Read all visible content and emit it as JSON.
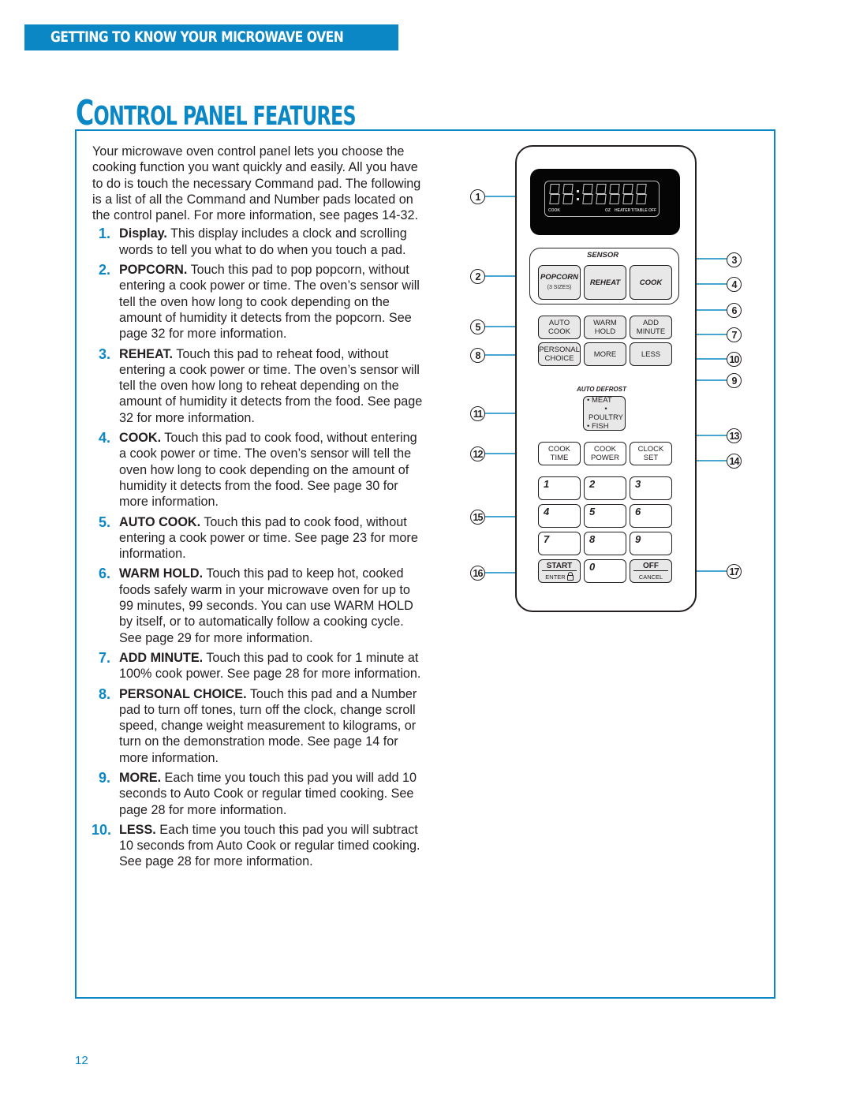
{
  "header": {
    "section_title": "GETTING TO KNOW YOUR MICROWAVE OVEN",
    "page_title_cap": "C",
    "page_title_rest": "ONTROL PANEL FEATURES"
  },
  "intro": "Your microwave oven control panel lets you choose the cooking function you want quickly and easily. All you have to do is touch the necessary Command pad. The following is a list of all the Command and Number pads located on the control panel. For more information, see pages 14-32.",
  "items": [
    {
      "num": "1.",
      "term": "Display.",
      "text": " This display includes a clock and scrolling words to tell you what to do when you touch a pad."
    },
    {
      "num": "2.",
      "term": "POPCORN.",
      "text": " Touch this pad to pop popcorn, without entering a cook power or time. The oven’s sensor will tell the oven how long to cook depending on the amount of humidity it detects from the popcorn. See page 32 for more information."
    },
    {
      "num": "3.",
      "term": "REHEAT.",
      "text": " Touch this pad to reheat food, without entering a cook power or time. The oven’s sensor will tell the oven how long to reheat depending on the amount of humidity it detects from the food. See page 32 for more information."
    },
    {
      "num": "4.",
      "term": "COOK.",
      "text": " Touch this pad to cook food, without entering a cook power or time. The oven’s sensor will tell the oven how long to cook depending on the amount of humidity it detects from the food. See page 30 for more information."
    },
    {
      "num": "5.",
      "term": "AUTO COOK.",
      "text": " Touch this pad to cook food, without entering a cook power or time. See page 23 for more information."
    },
    {
      "num": "6.",
      "term": "WARM HOLD.",
      "text": " Touch this pad to keep hot, cooked foods safely warm in your microwave oven for up to 99 minutes, 99 seconds. You can use WARM HOLD by itself, or to automatically follow a cooking cycle. See page 29 for more information."
    },
    {
      "num": "7.",
      "term": "ADD MINUTE.",
      "text": " Touch this pad to cook for 1 minute at 100% cook power. See page 28 for more information."
    },
    {
      "num": "8.",
      "term": "PERSONAL CHOICE.",
      "text": " Touch this pad and a Number pad to turn off tones, turn off the clock, change scroll speed, change weight measurement to kilograms, or turn on the demonstration mode. See page 14 for more information."
    },
    {
      "num": "9.",
      "term": "MORE.",
      "text": " Each time you touch this pad you will add 10 seconds to Auto Cook or regular timed cooking. See page 28 for more information."
    },
    {
      "num": "10.",
      "term": "LESS.",
      "text": " Each time you touch this pad you will subtract 10 seconds from Auto Cook or regular timed cooking. See page 28 for more information."
    }
  ],
  "page_number": "12",
  "panel": {
    "display_labels": [
      "COOK",
      "OZ",
      "HEATER",
      "T/TABLE",
      "OFF"
    ],
    "sensor_label": "SENSOR",
    "auto_defrost_label": "AUTO DEFROST",
    "pads": {
      "popcorn": "POPCORN",
      "popcorn_sub": "(3 SIZES)",
      "reheat": "REHEAT",
      "cook": "COOK",
      "auto_cook_1": "AUTO",
      "auto_cook_2": "COOK",
      "warm_hold_1": "WARM",
      "warm_hold_2": "HOLD",
      "add_minute_1": "ADD",
      "add_minute_2": "MINUTE",
      "personal_choice_1": "PERSONAL",
      "personal_choice_2": "CHOICE",
      "more": "MORE",
      "less": "LESS",
      "defrost_1": "• MEAT",
      "defrost_2": "• POULTRY",
      "defrost_3": "• FISH",
      "cook_time_1": "COOK",
      "cook_time_2": "TIME",
      "cook_power_1": "COOK",
      "cook_power_2": "POWER",
      "clock_set_1": "CLOCK",
      "clock_set_2": "SET",
      "n1": "1",
      "n2": "2",
      "n3": "3",
      "n4": "4",
      "n5": "5",
      "n6": "6",
      "n7": "7",
      "n8": "8",
      "n9": "9",
      "n0": "0",
      "start": "START",
      "enter": "ENTER",
      "off": "OFF",
      "cancel": "CANCEL"
    },
    "callouts": [
      "1",
      "2",
      "3",
      "4",
      "5",
      "6",
      "7",
      "8",
      "9",
      "10",
      "11",
      "12",
      "13",
      "14",
      "15",
      "16",
      "17"
    ]
  },
  "colors": {
    "accent": "#0a87c4",
    "text": "#231f20",
    "pad_gray": "#e8e8e8"
  }
}
